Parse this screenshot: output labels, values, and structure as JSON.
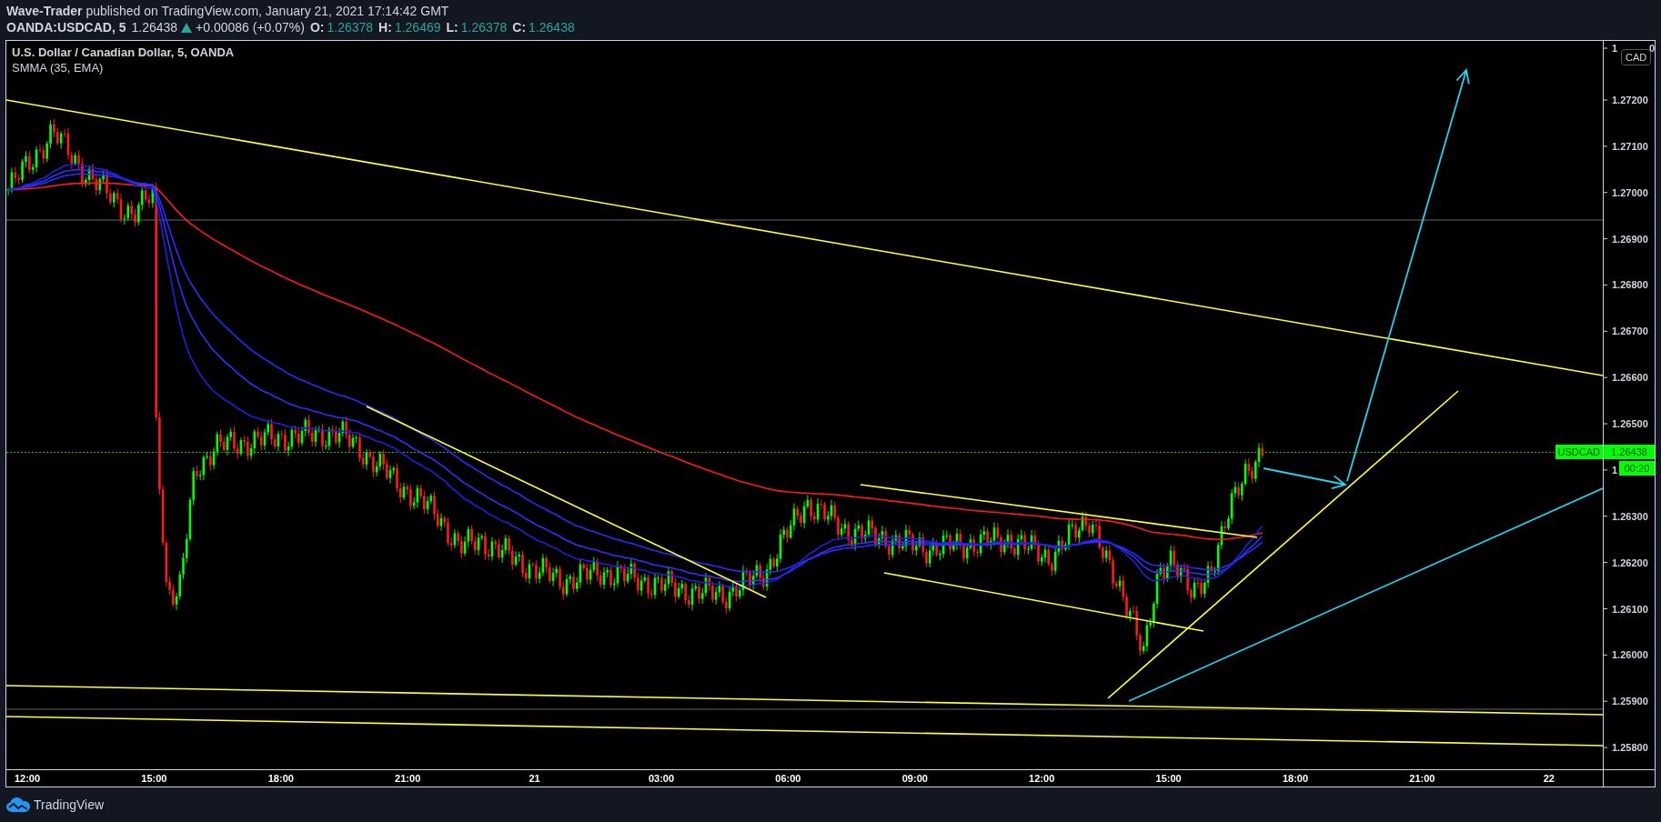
{
  "header": {
    "publish_line": "**Wave-Trader** published on TradingView.com, January 21, 2021 17:14:42 GMT",
    "symbol": "OANDA:USDCAD, 5",
    "last": "1.26438",
    "rising": true,
    "change": "+0.00086 (+0.07%)",
    "ohlc": [
      {
        "label": "O:",
        "value": "1.26378"
      },
      {
        "label": "H:",
        "value": "1.26469"
      },
      {
        "label": "L:",
        "value": "1.26378"
      },
      {
        "label": "C:",
        "value": "1.26438"
      }
    ]
  },
  "chart": {
    "title": "U.S. Dollar / Canadian Dollar, 5, OANDA",
    "indicator": "SMMA (35, EMA)",
    "price_axis": {
      "currency": "CAD",
      "top_tick_parts": [
        "1",
        "0"
      ],
      "ticks": [
        "1.27200",
        "1.27100",
        "1.27000",
        "1.26900",
        "1.26800",
        "1.26700",
        "1.26600",
        "1.26500",
        "1",
        "1.26300",
        "1.26200",
        "1.26100",
        "1.26000",
        "1.25900",
        "1.25800"
      ]
    },
    "last_price": {
      "symbol": "USDCAD",
      "price": "1.26438",
      "countdown": "00:20"
    },
    "time_axis": [
      "12:00",
      "15:00",
      "18:00",
      "21:00",
      "21",
      "03:00",
      "06:00",
      "09:00",
      "12:00",
      "15:00",
      "18:00",
      "21:00",
      "22"
    ]
  },
  "footer": {
    "brand": "TradingView"
  }
}
